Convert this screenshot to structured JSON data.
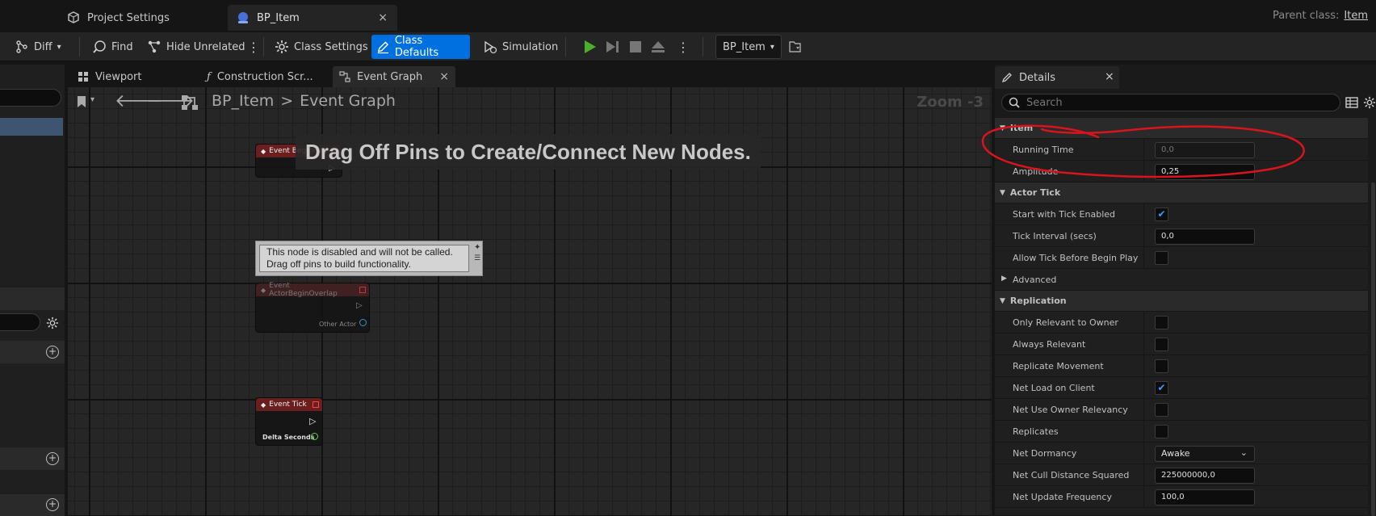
{
  "tabs": {
    "project_settings": "Project Settings",
    "bp_item": "BP_Item",
    "close": "×"
  },
  "parent_class": {
    "label": "Parent class:",
    "value": "Item"
  },
  "toolbar": {
    "diff": "Diff",
    "find": "Find",
    "hide_unrelated": "Hide Unrelated",
    "class_settings": "Class Settings",
    "class_defaults": "Class Defaults",
    "simulation": "Simulation",
    "blueprint_dropdown": "BP_Item"
  },
  "graph_tabs": {
    "viewport": "Viewport",
    "construction": "Construction Scr...",
    "event_graph": "Event Graph",
    "close": "×"
  },
  "breadcrumb": {
    "root": "BP_Item",
    "sep": ">",
    "current": "Event Graph"
  },
  "zoom": "Zoom -3",
  "hint": "Drag Off Pins to Create/Connect New Nodes.",
  "disabled_note": {
    "line1": "This node is disabled and will not be called.",
    "line2": "Drag off pins to build functionality."
  },
  "nodes": {
    "begin_play": {
      "title": "Event BeginPlay"
    },
    "overlap": {
      "title": "Event ActorBeginOverlap",
      "pin": "Other Actor"
    },
    "tick": {
      "title": "Event Tick",
      "pin": "Delta Seconds"
    }
  },
  "details": {
    "title": "Details",
    "close": "×",
    "search_placeholder": "Search",
    "sections": {
      "item": "Item",
      "actor_tick": "Actor Tick",
      "advanced": "Advanced",
      "replication": "Replication"
    },
    "props": {
      "running_time": {
        "label": "Running Time",
        "value": "0,0"
      },
      "amplitude": {
        "label": "Amplitude",
        "value": "0,25"
      },
      "start_tick": {
        "label": "Start with Tick Enabled",
        "checked": true
      },
      "tick_interval": {
        "label": "Tick Interval (secs)",
        "value": "0,0"
      },
      "allow_tick": {
        "label": "Allow Tick Before Begin Play",
        "checked": false
      },
      "only_relevant": {
        "label": "Only Relevant to Owner",
        "checked": false
      },
      "always_relevant": {
        "label": "Always Relevant",
        "checked": false
      },
      "replicate_movement": {
        "label": "Replicate Movement",
        "checked": false
      },
      "net_load": {
        "label": "Net Load on Client",
        "checked": true
      },
      "net_owner_rel": {
        "label": "Net Use Owner Relevancy",
        "checked": false
      },
      "replicates": {
        "label": "Replicates",
        "checked": false
      },
      "net_dormancy": {
        "label": "Net Dormancy",
        "value": "Awake"
      },
      "net_cull": {
        "label": "Net Cull Distance Squared",
        "value": "225000000,0"
      },
      "net_update": {
        "label": "Net Update Frequency",
        "value": "100,0"
      }
    },
    "check_mark": "✔"
  },
  "colors": {
    "accent": "#0070e0",
    "node_header": "#6b1e1e",
    "annotation": "#d9141c",
    "play": "#4caf2c"
  }
}
